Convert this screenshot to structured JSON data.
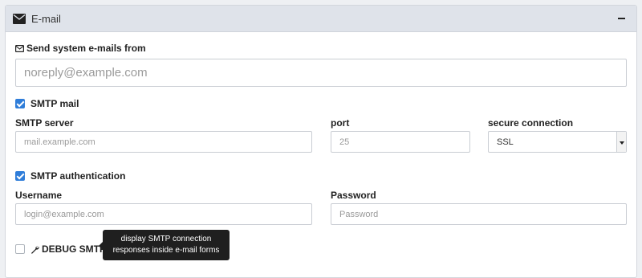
{
  "panel": {
    "title": "E-mail",
    "icon": "envelope-icon",
    "collapse_icon": "minus-icon"
  },
  "sender": {
    "label": "Send system e-mails from",
    "icon": "envelope-outline-icon",
    "placeholder": "noreply@example.com"
  },
  "smtp_mail": {
    "label": "SMTP mail",
    "checked": true
  },
  "smtp_server": {
    "label": "SMTP server",
    "placeholder": "mail.example.com"
  },
  "port": {
    "label": "port",
    "placeholder": "25"
  },
  "secure_connection": {
    "label": "secure connection",
    "value": "SSL"
  },
  "smtp_auth": {
    "label": "SMTP authentication",
    "checked": true
  },
  "username": {
    "label": "Username",
    "placeholder": "login@example.com"
  },
  "password": {
    "label": "Password",
    "placeholder": "Password"
  },
  "debug": {
    "label": "DEBUG SMTP",
    "checked": false,
    "icon": "wrench-icon",
    "help_icon": "question-circle-icon",
    "tooltip_line1": "display SMTP connection",
    "tooltip_line2": "responses inside e-mail forms"
  },
  "colors": {
    "accent": "#2f7dd9",
    "header_bg": "#dfe3ea",
    "tooltip_bg": "#1f1f1f"
  }
}
